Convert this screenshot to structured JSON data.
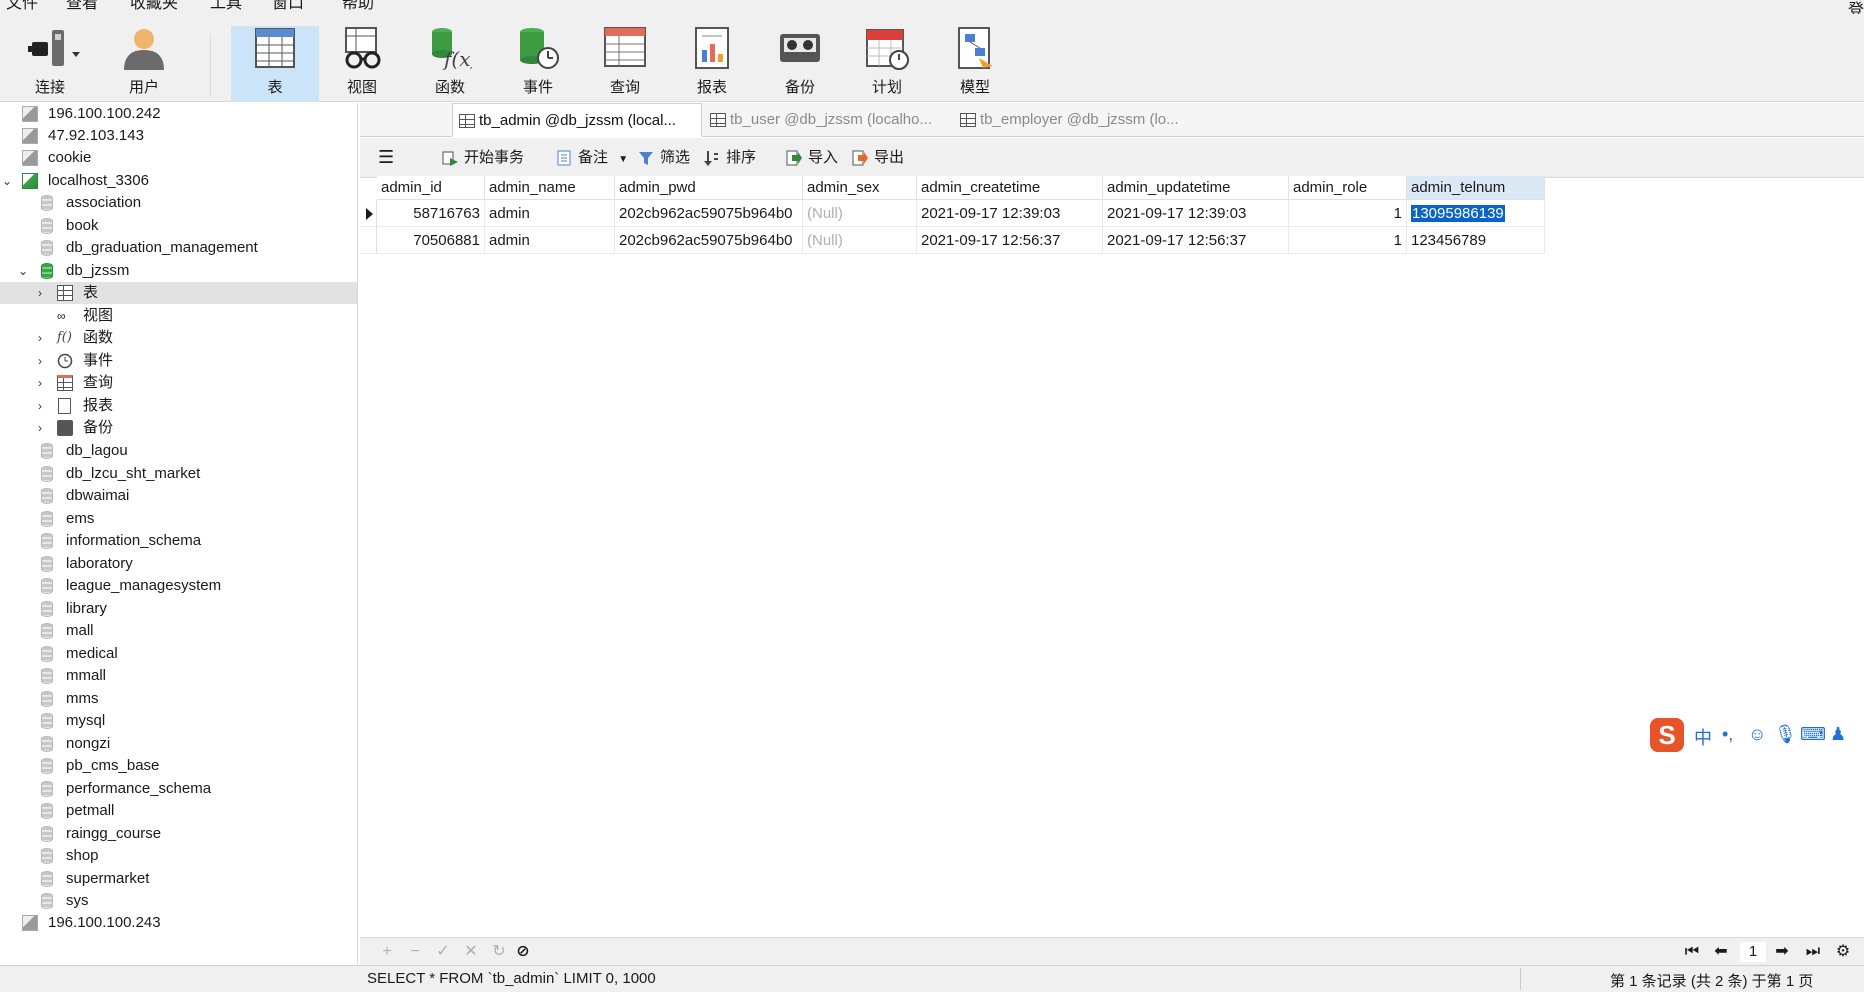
{
  "menu": [
    "文件",
    "查看",
    "收藏夹",
    "工具",
    "窗口",
    "帮助"
  ],
  "menu_right": "登",
  "toolbar": [
    {
      "label": "连接",
      "icon": "plug-icon"
    },
    {
      "label": "用户",
      "icon": "user-icon"
    },
    {
      "label": "表",
      "icon": "table-icon",
      "active": true
    },
    {
      "label": "视图",
      "icon": "view-glasses-icon"
    },
    {
      "label": "函数",
      "icon": "function-icon"
    },
    {
      "label": "事件",
      "icon": "event-clock-icon"
    },
    {
      "label": "查询",
      "icon": "query-icon"
    },
    {
      "label": "报表",
      "icon": "report-icon"
    },
    {
      "label": "备份",
      "icon": "backup-icon"
    },
    {
      "label": "计划",
      "icon": "schedule-calendar-icon"
    },
    {
      "label": "模型",
      "icon": "model-icon"
    }
  ],
  "tree": {
    "servers_top": [
      "196.100.100.242",
      "47.92.103.143",
      "cookie"
    ],
    "active_server": "localhost_3306",
    "dbs_before": [
      "association",
      "book",
      "db_graduation_management"
    ],
    "open_db": "db_jzssm",
    "open_db_children": [
      "表",
      "视图",
      "函数",
      "事件",
      "查询",
      "报表",
      "备份"
    ],
    "dbs_after": [
      "db_lagou",
      "db_lzcu_sht_market",
      "dbwaimai",
      "ems",
      "information_schema",
      "laboratory",
      "league_managesystem",
      "library",
      "mall",
      "medical",
      "mmall",
      "mms",
      "mysql",
      "nongzi",
      "pb_cms_base",
      "performance_schema",
      "petmall",
      "raingg_course",
      "shop",
      "supermarket",
      "sys"
    ],
    "server_bottom": "196.100.100.243"
  },
  "tabs": [
    {
      "label": "tb_admin @db_jzssm (local...",
      "active": true
    },
    {
      "label": "tb_user @db_jzssm (localho...",
      "active": false
    },
    {
      "label": "tb_employer @db_jzssm (lo...",
      "active": false
    }
  ],
  "objbar": {
    "begin_tx": "开始事务",
    "note": "备注",
    "filter": "筛选",
    "sort": "排序",
    "import": "导入",
    "export": "导出"
  },
  "grid": {
    "columns": [
      "admin_id",
      "admin_name",
      "admin_pwd",
      "admin_sex",
      "admin_createtime",
      "admin_updatetime",
      "admin_role",
      "admin_telnum"
    ],
    "rows": [
      [
        "58716763",
        "admin",
        "202cb962ac59075b964b0",
        "(Null)",
        "2021-09-17 12:39:03",
        "2021-09-17 12:39:03",
        "1",
        "13095986139"
      ],
      [
        "70506881",
        "admin",
        "202cb962ac59075b964b0",
        "(Null)",
        "2021-09-17 12:56:37",
        "2021-09-17 12:56:37",
        "1",
        "123456789"
      ]
    ]
  },
  "nav": {
    "page": "1"
  },
  "status": {
    "sql": "SELECT * FROM `tb_admin` LIMIT 0, 1000",
    "info": "第 1 条记录 (共 2 条) 于第 1 页"
  },
  "ime": {
    "logo": "S",
    "mode": "中",
    "punct": "•,"
  }
}
